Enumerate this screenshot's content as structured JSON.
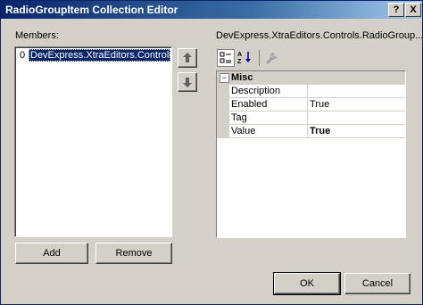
{
  "window": {
    "title": "RadioGroupItem Collection Editor"
  },
  "title_buttons": {
    "help": "?",
    "close": "X"
  },
  "members": {
    "label": "Members:",
    "items": [
      {
        "index": "0",
        "text": "DevExpress.XtraEditors.Controls"
      }
    ]
  },
  "property_panel": {
    "header": "DevExpress.XtraEditors.Controls.RadioGroup..."
  },
  "toolbar": {
    "categorized_icon": "categorized-icon",
    "alphabetical_icon": "alphabetical-icon",
    "properties_icon": "wrench-icon"
  },
  "property_grid": {
    "category": {
      "expander": "−",
      "name": "Misc"
    },
    "rows": [
      {
        "name": "Description",
        "value": ""
      },
      {
        "name": "Enabled",
        "value": "True"
      },
      {
        "name": "Tag",
        "value": ""
      },
      {
        "name": "Value",
        "value": "True"
      }
    ]
  },
  "buttons": {
    "add": "Add",
    "remove": "Remove",
    "ok": "OK",
    "cancel": "Cancel"
  },
  "colors": {
    "selection": "#0a246a",
    "face": "#d4d0c8",
    "title_start": "#0a246a",
    "title_end": "#a6caf0"
  }
}
